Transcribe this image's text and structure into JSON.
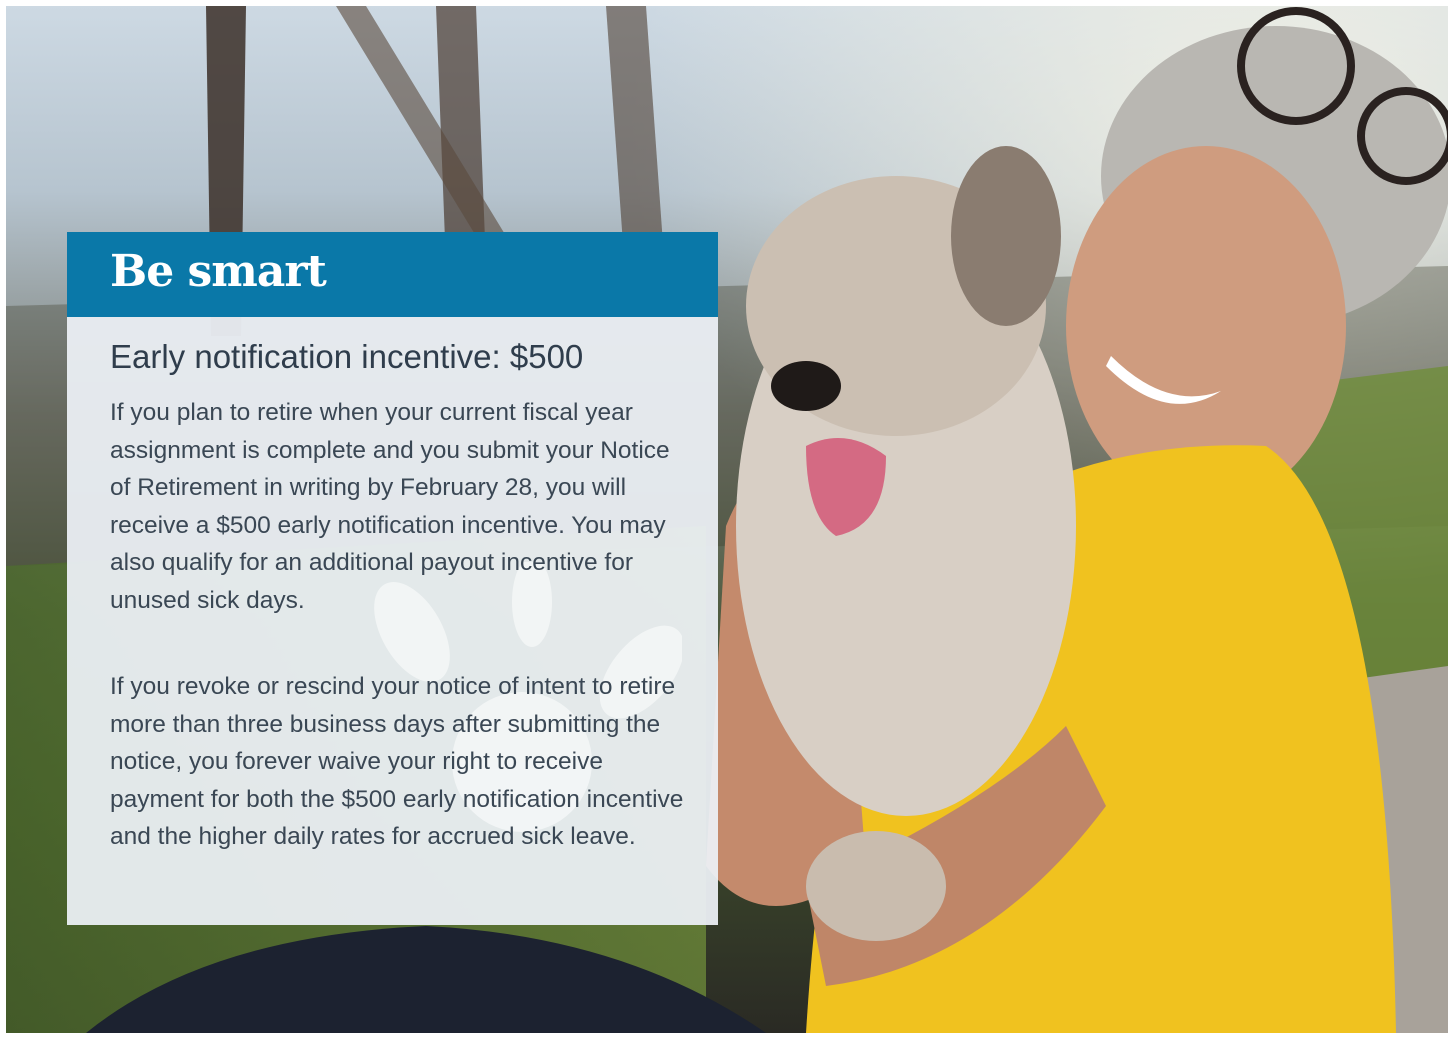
{
  "card": {
    "title": "Be smart",
    "subtitle": "Early notification incentive: $500",
    "paragraph_1": "If you plan to retire when your current fiscal year assignment is complete and you submit your Notice of Retirement in writing by February 28, you will receive a $500 early notification incentive. You may also qualify for an additional payout incentive for unused sick days.",
    "paragraph_2": "If you revoke or rescind your notice of intent to retire more than three business days after submitting the notice, you forever waive your right to receive payment for both the $500 early notification incentive and the higher daily rates for accrued sick leave."
  },
  "colors": {
    "header": "#0a78a8",
    "card_background": "#ecf0f5",
    "subtitle_text": "#2f3d4c",
    "body_text": "#3a4754"
  }
}
